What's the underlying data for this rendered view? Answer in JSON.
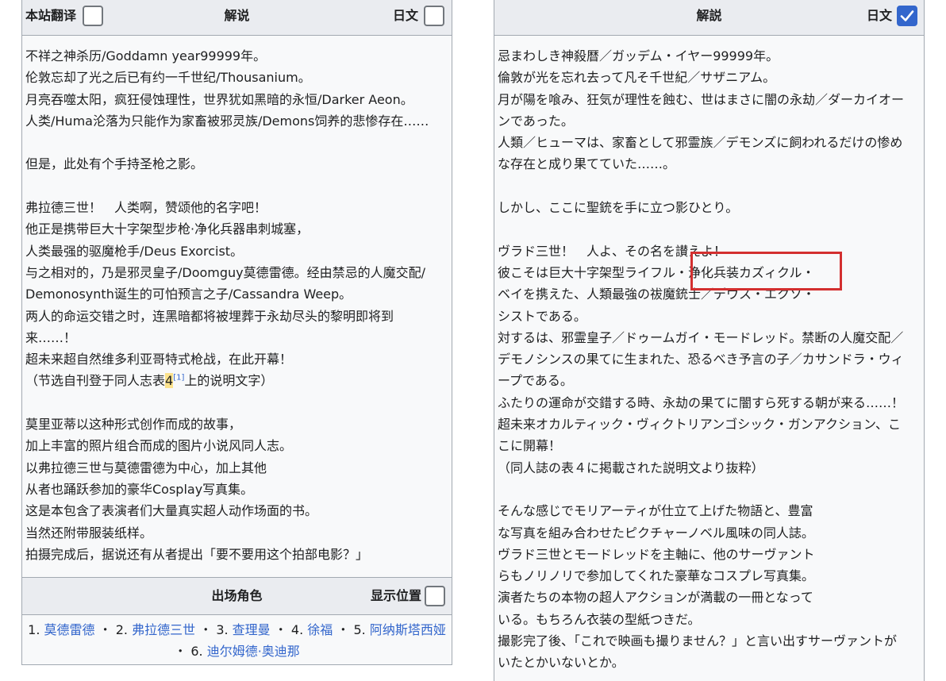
{
  "left": {
    "header": {
      "site_translation_label": "本站翻译",
      "title": "解说",
      "japanese_label": "日文"
    },
    "text_lines": [
      "不祥之神杀历/Goddamn year99999年。",
      "伦敦忘却了光之后已有约一千世纪/Thousanium。",
      "月亮吞噬太阳，疯狂侵蚀理性，世界犹如黑暗的永恒/Darker Aeon。",
      "人类/Huma沦落为只能作为家畜被邪灵族/Demons饲养的悲惨存在……",
      "",
      "但是，此处有个手持圣枪之影。",
      "",
      "弗拉德三世！　人类啊，赞颂他的名字吧！",
      "他正是携带巨大十字架型步枪·净化兵器串刺城塞，",
      "人类最强的驱魔枪手/Deus Exorcist。",
      "与之相对的，乃是邪灵皇子/Doomguy莫德雷德。经由禁忌的人魔交配/",
      "Demonosynth诞生的可怕预言之子/Cassandra Weep。",
      "两人的命运交错之时，连黑暗都将被埋葬于永劫尽头的黎明即将到",
      "来……！",
      "超未来超自然维多利亚哥特式枪战，在此开幕！"
    ],
    "citation": {
      "before": "（节选自刊登于同人志表",
      "highlight": "4",
      "sup": "[1]",
      "after": "上的说明文字）"
    },
    "text_lines_2": [
      "",
      "莫里亚蒂以这种形式创作而成的故事，",
      "加上丰富的照片组合而成的图片小说风同人志。",
      "以弗拉德三世与莫德雷德为中心，加上其他",
      "从者也踊跃参加的豪华Cosplay写真集。",
      "这是本包含了表演者们大量真实超人动作场面的书。",
      "当然还附带服装纸样。",
      "拍摄完成后，据说还有从者提出「要不要用这个拍部电影？」"
    ],
    "characters": {
      "title": "出场角色",
      "show_position_label": "显示位置",
      "items": [
        {
          "num": "1.",
          "name": "莫德雷德"
        },
        {
          "num": "2.",
          "name": "弗拉德三世"
        },
        {
          "num": "3.",
          "name": "查理曼"
        },
        {
          "num": "4.",
          "name": "徐福"
        },
        {
          "num": "5.",
          "name": "阿纳斯塔西娅"
        },
        {
          "num": "6.",
          "name": "迪尔姆德·奥迪那"
        }
      ],
      "separator": "・"
    }
  },
  "right": {
    "header": {
      "title": "解説",
      "japanese_label": "日文"
    },
    "text_lines": [
      "忌まわしき神殺暦／ガッデム・イヤー99999年。",
      "倫敦が光を忘れ去って凡そ千世紀／サザニアム。",
      "月が陽を喰み、狂気が理性を蝕む、世はまさに闇の永劫／ダーカイオー",
      "ンであった。",
      "人類／ヒューマは、家畜として邪霊族／デモンズに飼われるだけの惨め",
      "な存在と成り果てていた……。",
      "",
      "しかし、ここに聖銃を手に立つ影ひとり。",
      "",
      "ヴラド三世！　人よ、その名を讃えよ！",
      "彼こそは巨大十字架型ライフル・浄化兵装カズィクル・",
      "ベイを携えた、人類最強の祓魔銃士／デウス・エクソ・",
      "シストである。",
      "対するは、邪霊皇子／ドゥームガイ・モードレッド。禁断の人魔交配／",
      "デモノシンスの果てに生まれた、恐るべき予言の子／カサンドラ・ウィ",
      "ープである。",
      "ふたりの運命が交錯する時、永劫の果てに闇すら死する朝が来る……！",
      "超未来オカルティック・ヴィクトリアンゴシック・ガンアクション、こ",
      "こに開幕！",
      "（同人誌の表４に掲載された説明文より抜粋）",
      "",
      "そんな感じでモリアーティが仕立て上げた物語と、豊富",
      "な写真を組み合わせたピクチャーノベル風味の同人誌。",
      "ヴラド三世とモードレッドを主軸に、他のサーヴァント",
      "らもノリノリで参加してくれた豪華なコスプレ写真集。",
      "演者たちの本物の超人アクションが満載の一冊となって",
      "いる。もちろん衣装の型紙つきだ。",
      "撮影完了後、「これで映画も撮りません？」と言い出すサーヴァントが",
      "いたとかいないとか。"
    ]
  },
  "colors": {
    "link": "#3366cc",
    "checkbox_checked": "#3366cc",
    "highlight": "#fce28c",
    "annotation_box": "#d32f2f"
  }
}
